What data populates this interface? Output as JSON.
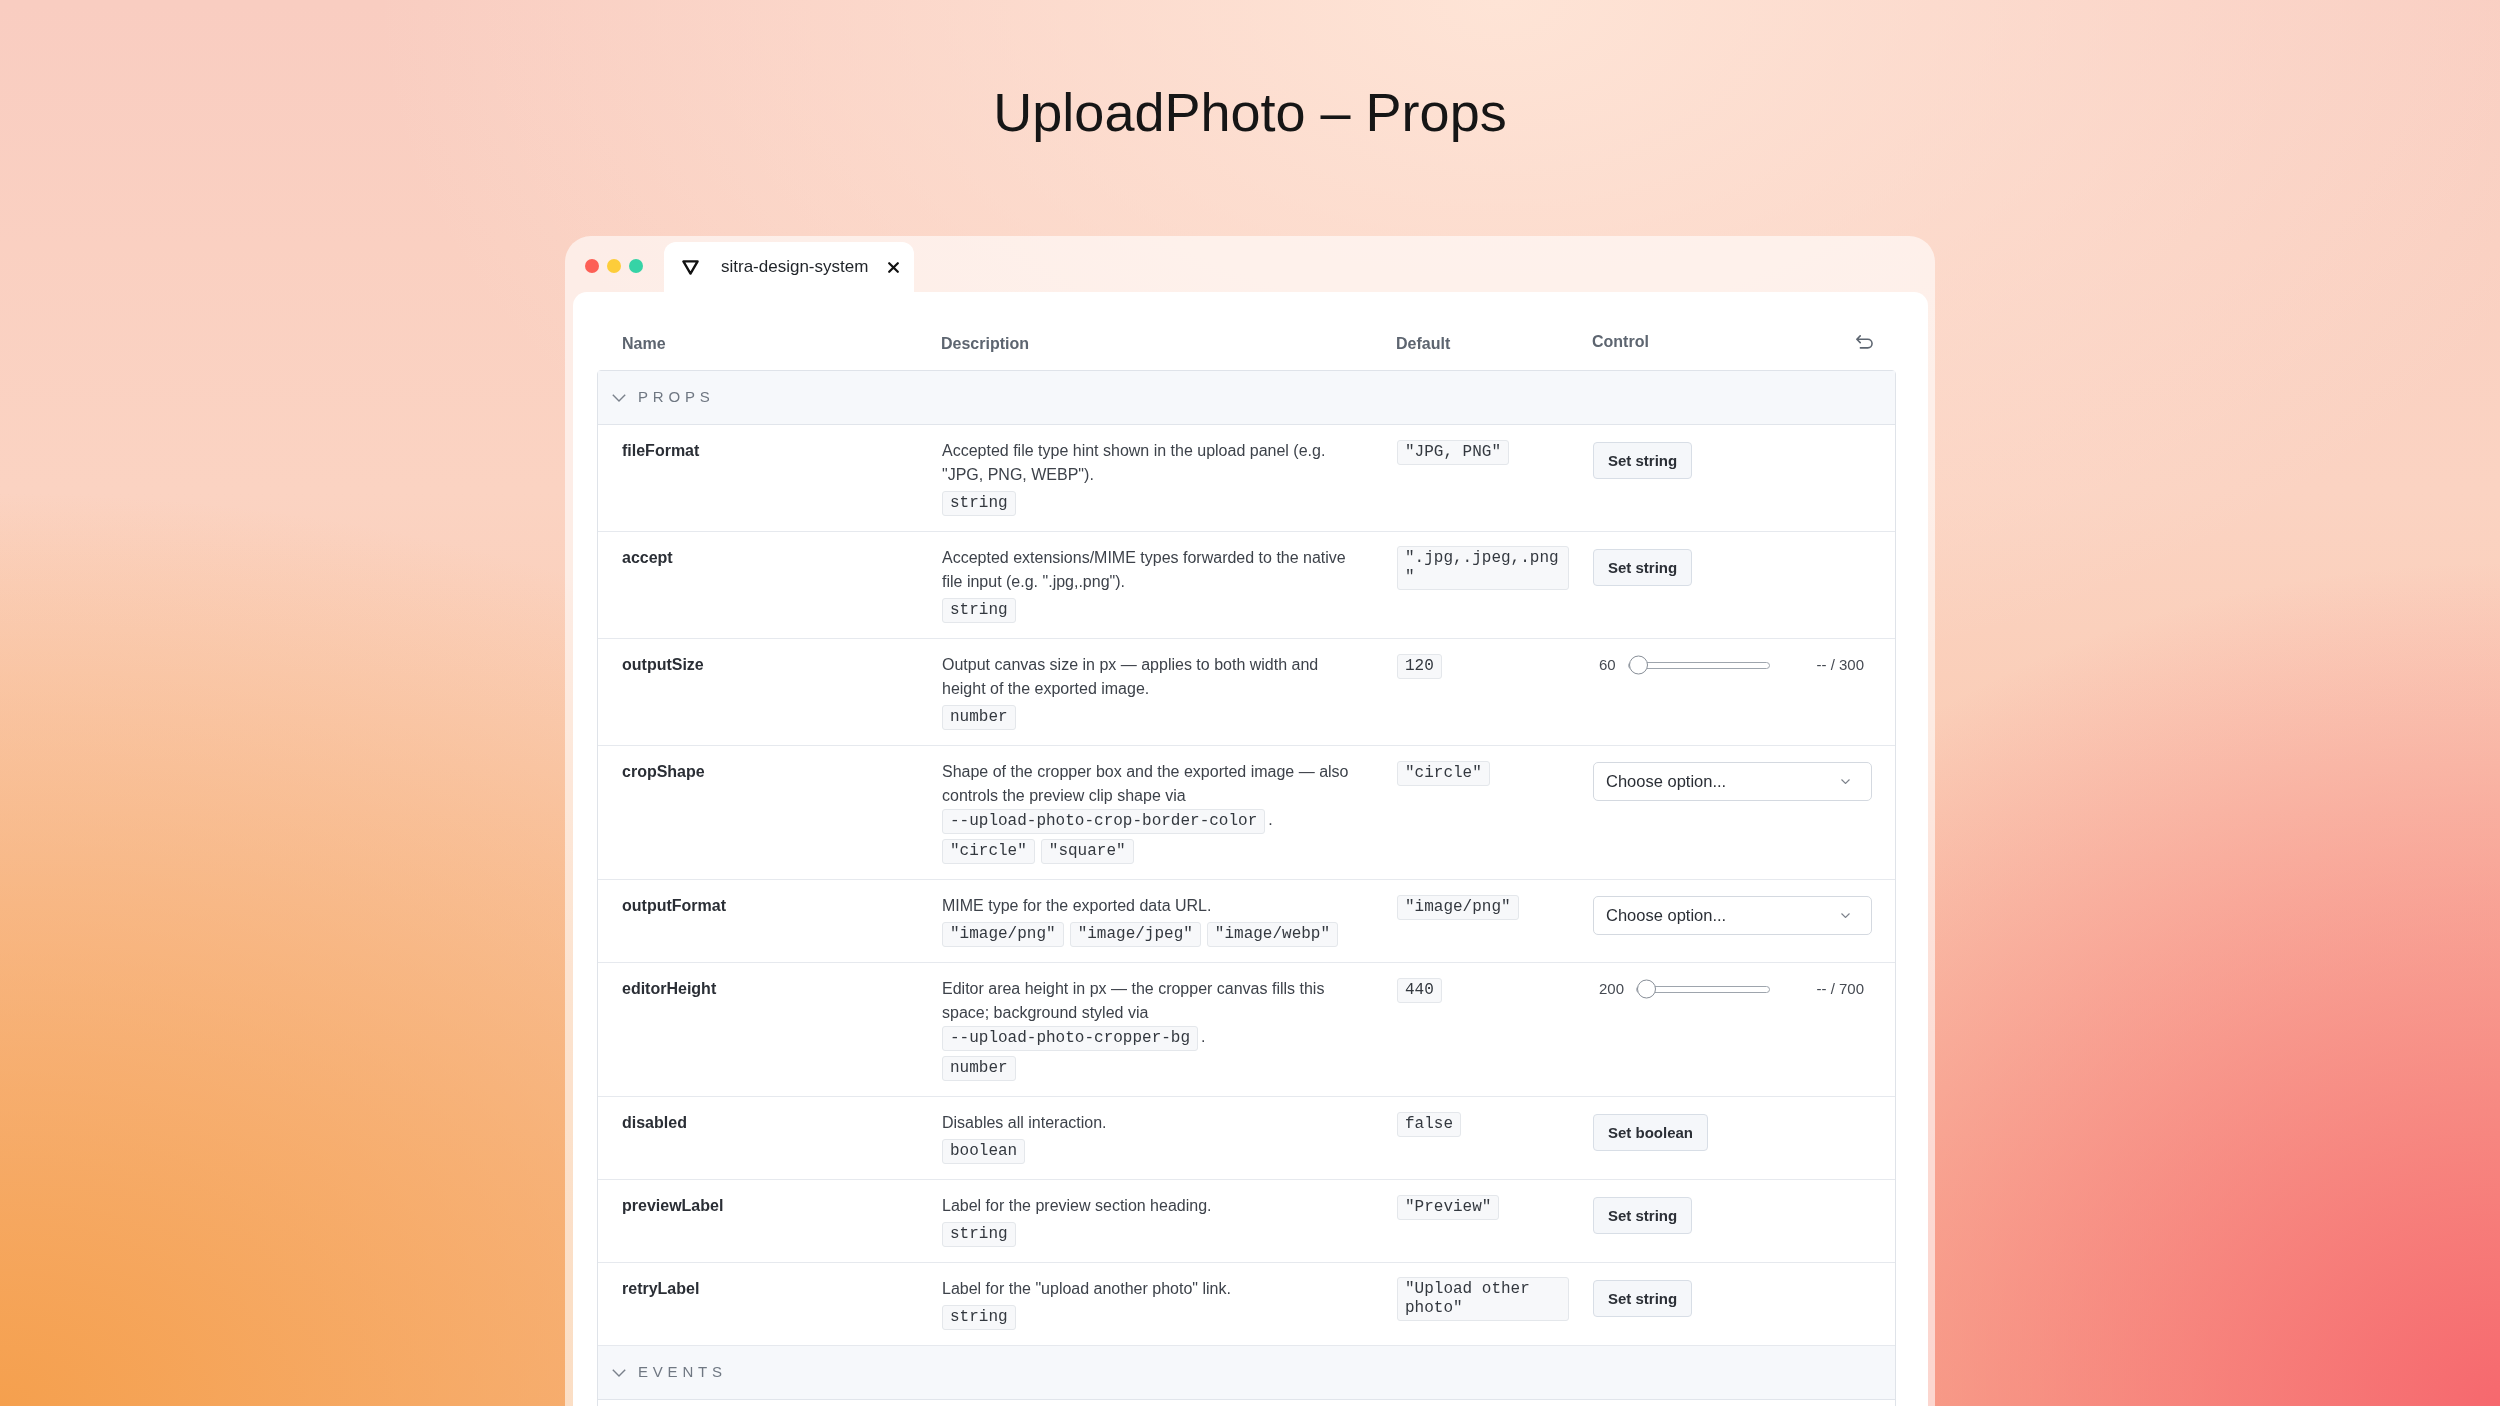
{
  "title": "UploadPhoto – Props",
  "window": {
    "tab": {
      "label": "sitra-design-system"
    }
  },
  "table": {
    "columns": [
      "Name",
      "Description",
      "Default",
      "Control"
    ],
    "sections": [
      {
        "label": "PROPS",
        "expanded": true,
        "rows": [
          {
            "name": "fileFormat",
            "description": [
              {
                "kind": "text",
                "text": "Accepted file type hint shown in the upload panel (e.g. \"JPG, PNG, WEBP\")."
              }
            ],
            "types": [
              "string"
            ],
            "default": "\"JPG, PNG\"",
            "control": {
              "kind": "button",
              "label": "Set string"
            }
          },
          {
            "name": "accept",
            "description": [
              {
                "kind": "text",
                "text": "Accepted extensions/MIME types forwarded to the native file input (e.g. \".jpg,.png\")."
              }
            ],
            "types": [
              "string"
            ],
            "default": "\".jpg,.jpeg,.png\"",
            "control": {
              "kind": "button",
              "label": "Set string"
            }
          },
          {
            "name": "outputSize",
            "description": [
              {
                "kind": "text",
                "text": "Output canvas size in px — applies to both width and height of the exported image."
              }
            ],
            "types": [
              "number"
            ],
            "default": "120",
            "control": {
              "kind": "slider",
              "min_label": "60",
              "max_label": "-- / 300",
              "level": 0
            }
          },
          {
            "name": "cropShape",
            "description": [
              {
                "kind": "text",
                "text": "Shape of the cropper box and the exported image — also controls the preview clip shape via"
              },
              {
                "kind": "code",
                "text": "--upload-photo-crop-border-color"
              },
              {
                "kind": "text",
                "text": "."
              }
            ],
            "types": [
              "\"circle\"",
              "\"square\""
            ],
            "default": "\"circle\"",
            "control": {
              "kind": "select",
              "placeholder": "Choose option..."
            }
          },
          {
            "name": "outputFormat",
            "description": [
              {
                "kind": "text",
                "text": "MIME type for the exported data URL."
              }
            ],
            "types": [
              "\"image/png\"",
              "\"image/jpeg\"",
              "\"image/webp\""
            ],
            "default": "\"image/png\"",
            "control": {
              "kind": "select",
              "placeholder": "Choose option..."
            }
          },
          {
            "name": "editorHeight",
            "description": [
              {
                "kind": "text",
                "text": "Editor area height in px — the cropper canvas fills this space; background styled via"
              },
              {
                "kind": "code",
                "text": "--upload-photo-cropper-bg"
              },
              {
                "kind": "text",
                "text": "."
              }
            ],
            "types": [
              "number"
            ],
            "default": "440",
            "control": {
              "kind": "slider",
              "min_label": "200",
              "max_label": "-- / 700",
              "level": 0
            }
          },
          {
            "name": "disabled",
            "description": [
              {
                "kind": "text",
                "text": "Disables all interaction."
              }
            ],
            "types": [
              "boolean"
            ],
            "default": "false",
            "control": {
              "kind": "button",
              "label": "Set boolean"
            }
          },
          {
            "name": "previewLabel",
            "description": [
              {
                "kind": "text",
                "text": "Label for the preview section heading."
              }
            ],
            "types": [
              "string"
            ],
            "default": "\"Preview\"",
            "control": {
              "kind": "button",
              "label": "Set string"
            }
          },
          {
            "name": "retryLabel",
            "description": [
              {
                "kind": "text",
                "text": "Label for the \"upload another photo\" link."
              }
            ],
            "types": [
              "string"
            ],
            "default": "\"Upload other photo\"",
            "control": {
              "kind": "button",
              "label": "Set string"
            }
          }
        ]
      },
      {
        "label": "EVENTS",
        "expanded": true
      }
    ]
  }
}
